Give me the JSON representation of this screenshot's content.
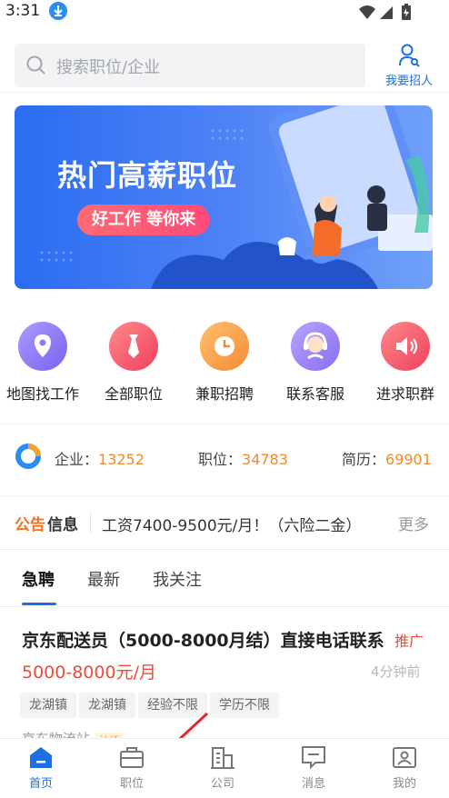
{
  "status_bar": {
    "time": "3:31",
    "download_icon": "download-icon"
  },
  "header": {
    "search_placeholder": "搜索职位/企业",
    "recruit_label": "我要招人"
  },
  "banner": {
    "title": "热门高薪职位",
    "pill": "好工作 等你来"
  },
  "quick_menu": [
    {
      "label": "地图找工作",
      "icon": "map-pin-icon",
      "color": "#8a7cf6"
    },
    {
      "label": "全部职位",
      "icon": "tie-icon",
      "color": "#f0566a"
    },
    {
      "label": "兼职招聘",
      "icon": "clock-icon",
      "color": "#f9a04a"
    },
    {
      "label": "联系客服",
      "icon": "service-icon",
      "color": "#9a7ff0"
    },
    {
      "label": "进求职群",
      "icon": "speaker-icon",
      "color": "#f0566a"
    }
  ],
  "stats": {
    "company_label": "企业：",
    "company_value": "13252",
    "job_label": "职位：",
    "job_value": "34783",
    "resume_label": "简历：",
    "resume_value": "69901"
  },
  "notice": {
    "tag_a": "公告",
    "tag_b": "信息",
    "text": "工资7400-9500元/月！（六险二金）",
    "more": "更多"
  },
  "tabs": [
    "急聘",
    "最新",
    "我关注"
  ],
  "job": {
    "title": "京东配送员（5000-8000月结）直接电话联系",
    "badge": "推广",
    "salary": "5000-8000元/月",
    "time": "4分钟前",
    "tags": [
      "龙湖镇",
      "龙湖镇",
      "经验不限",
      "学历不限"
    ],
    "company": "京东物流站",
    "company_auth": "认证"
  },
  "bottom_nav": [
    {
      "label": "首页",
      "icon": "home-icon",
      "active": true
    },
    {
      "label": "职位",
      "icon": "briefcase-icon",
      "active": false
    },
    {
      "label": "公司",
      "icon": "building-icon",
      "active": false
    },
    {
      "label": "消息",
      "icon": "message-icon",
      "active": false
    },
    {
      "label": "我的",
      "icon": "profile-icon",
      "active": false
    }
  ],
  "colors": {
    "accent": "#1f6fe0",
    "price": "#f04a3a",
    "stat_value": "#f08a2a"
  }
}
